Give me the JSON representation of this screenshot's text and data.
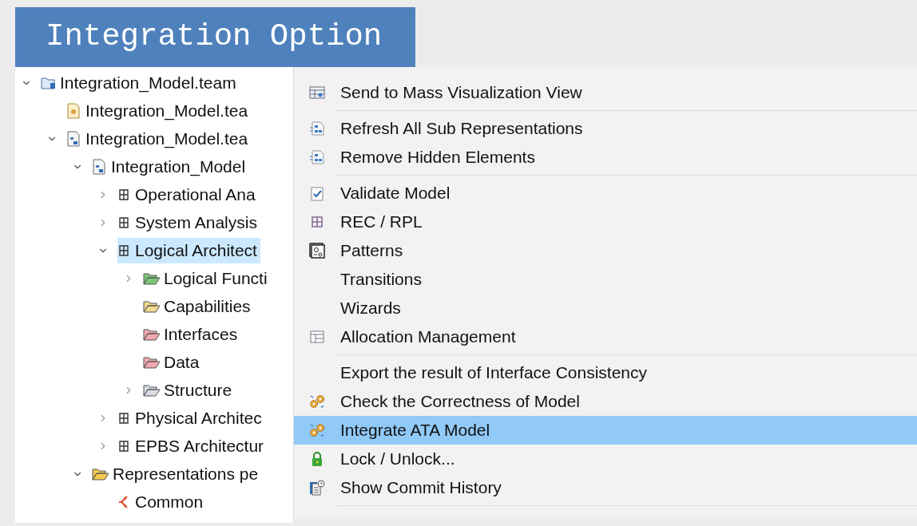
{
  "banner": {
    "title": "Integration Option"
  },
  "tree": [
    {
      "label": "Integration_Model.team",
      "kind": "project",
      "expanded": true,
      "selected": false,
      "children": [
        {
          "label": "Integration_Model.tea",
          "kind": "file",
          "selected": false
        },
        {
          "label": "Integration_Model.tea",
          "kind": "model",
          "expanded": true,
          "selected": false,
          "children": [
            {
              "label": "Integration_Model",
              "kind": "model",
              "expanded": true,
              "selected": false,
              "children": [
                {
                  "label": "Operational Ana",
                  "kind": "package",
                  "expanded": false,
                  "selected": false
                },
                {
                  "label": "System Analysis",
                  "kind": "package",
                  "expanded": false,
                  "selected": false
                },
                {
                  "label": "Logical Architect",
                  "kind": "package",
                  "expanded": true,
                  "selected": true,
                  "children": [
                    {
                      "label": "Logical Functi",
                      "kind": "folder",
                      "color": "#7cc576",
                      "expanded": false,
                      "selected": false
                    },
                    {
                      "label": "Capabilities",
                      "kind": "folder",
                      "color": "#f0d890",
                      "selected": false
                    },
                    {
                      "label": "Interfaces",
                      "kind": "folder",
                      "color": "#f0a8b0",
                      "selected": false
                    },
                    {
                      "label": "Data",
                      "kind": "folder",
                      "color": "#f0a8b0",
                      "selected": false
                    },
                    {
                      "label": "Structure",
                      "kind": "folder",
                      "color": "#d8dce4",
                      "expanded": false,
                      "selected": false
                    }
                  ]
                },
                {
                  "label": "Physical Architec",
                  "kind": "package",
                  "expanded": false,
                  "selected": false
                },
                {
                  "label": "EPBS Architectur",
                  "kind": "package",
                  "expanded": false,
                  "selected": false
                }
              ]
            },
            {
              "label": "Representations pe",
              "kind": "folder",
              "color": "#f5c851",
              "expanded": true,
              "selected": false,
              "children": [
                {
                  "label": "Common",
                  "kind": "diagram",
                  "selected": false
                }
              ]
            }
          ]
        }
      ]
    }
  ],
  "menu": [
    {
      "kind": "table",
      "label": "Send to Mass Visualization View",
      "selected": false
    },
    {
      "kind": "separator"
    },
    {
      "kind": "representations",
      "label": "Refresh All Sub Representations",
      "selected": false
    },
    {
      "kind": "representations",
      "label": "Remove Hidden Elements",
      "selected": false
    },
    {
      "kind": "separator"
    },
    {
      "kind": "validate",
      "label": "Validate Model",
      "selected": false
    },
    {
      "kind": "grid",
      "label": "REC / RPL",
      "selected": false
    },
    {
      "kind": "patterns",
      "label": "Patterns",
      "selected": false
    },
    {
      "kind": "plain",
      "label": "Transitions",
      "selected": false
    },
    {
      "kind": "plain",
      "label": "Wizards",
      "selected": false
    },
    {
      "kind": "layout",
      "label": "Allocation Management",
      "selected": false
    },
    {
      "kind": "separator"
    },
    {
      "kind": "plain",
      "label": "Export the result of Interface Consistency",
      "selected": false
    },
    {
      "kind": "gears",
      "label": "Check the Correctness of Model",
      "selected": false
    },
    {
      "kind": "gears",
      "label": "Integrate ATA Model",
      "selected": true
    },
    {
      "kind": "lock",
      "label": "Lock / Unlock...",
      "selected": false
    },
    {
      "kind": "history",
      "label": "Show Commit History",
      "selected": false
    },
    {
      "kind": "separator"
    }
  ]
}
